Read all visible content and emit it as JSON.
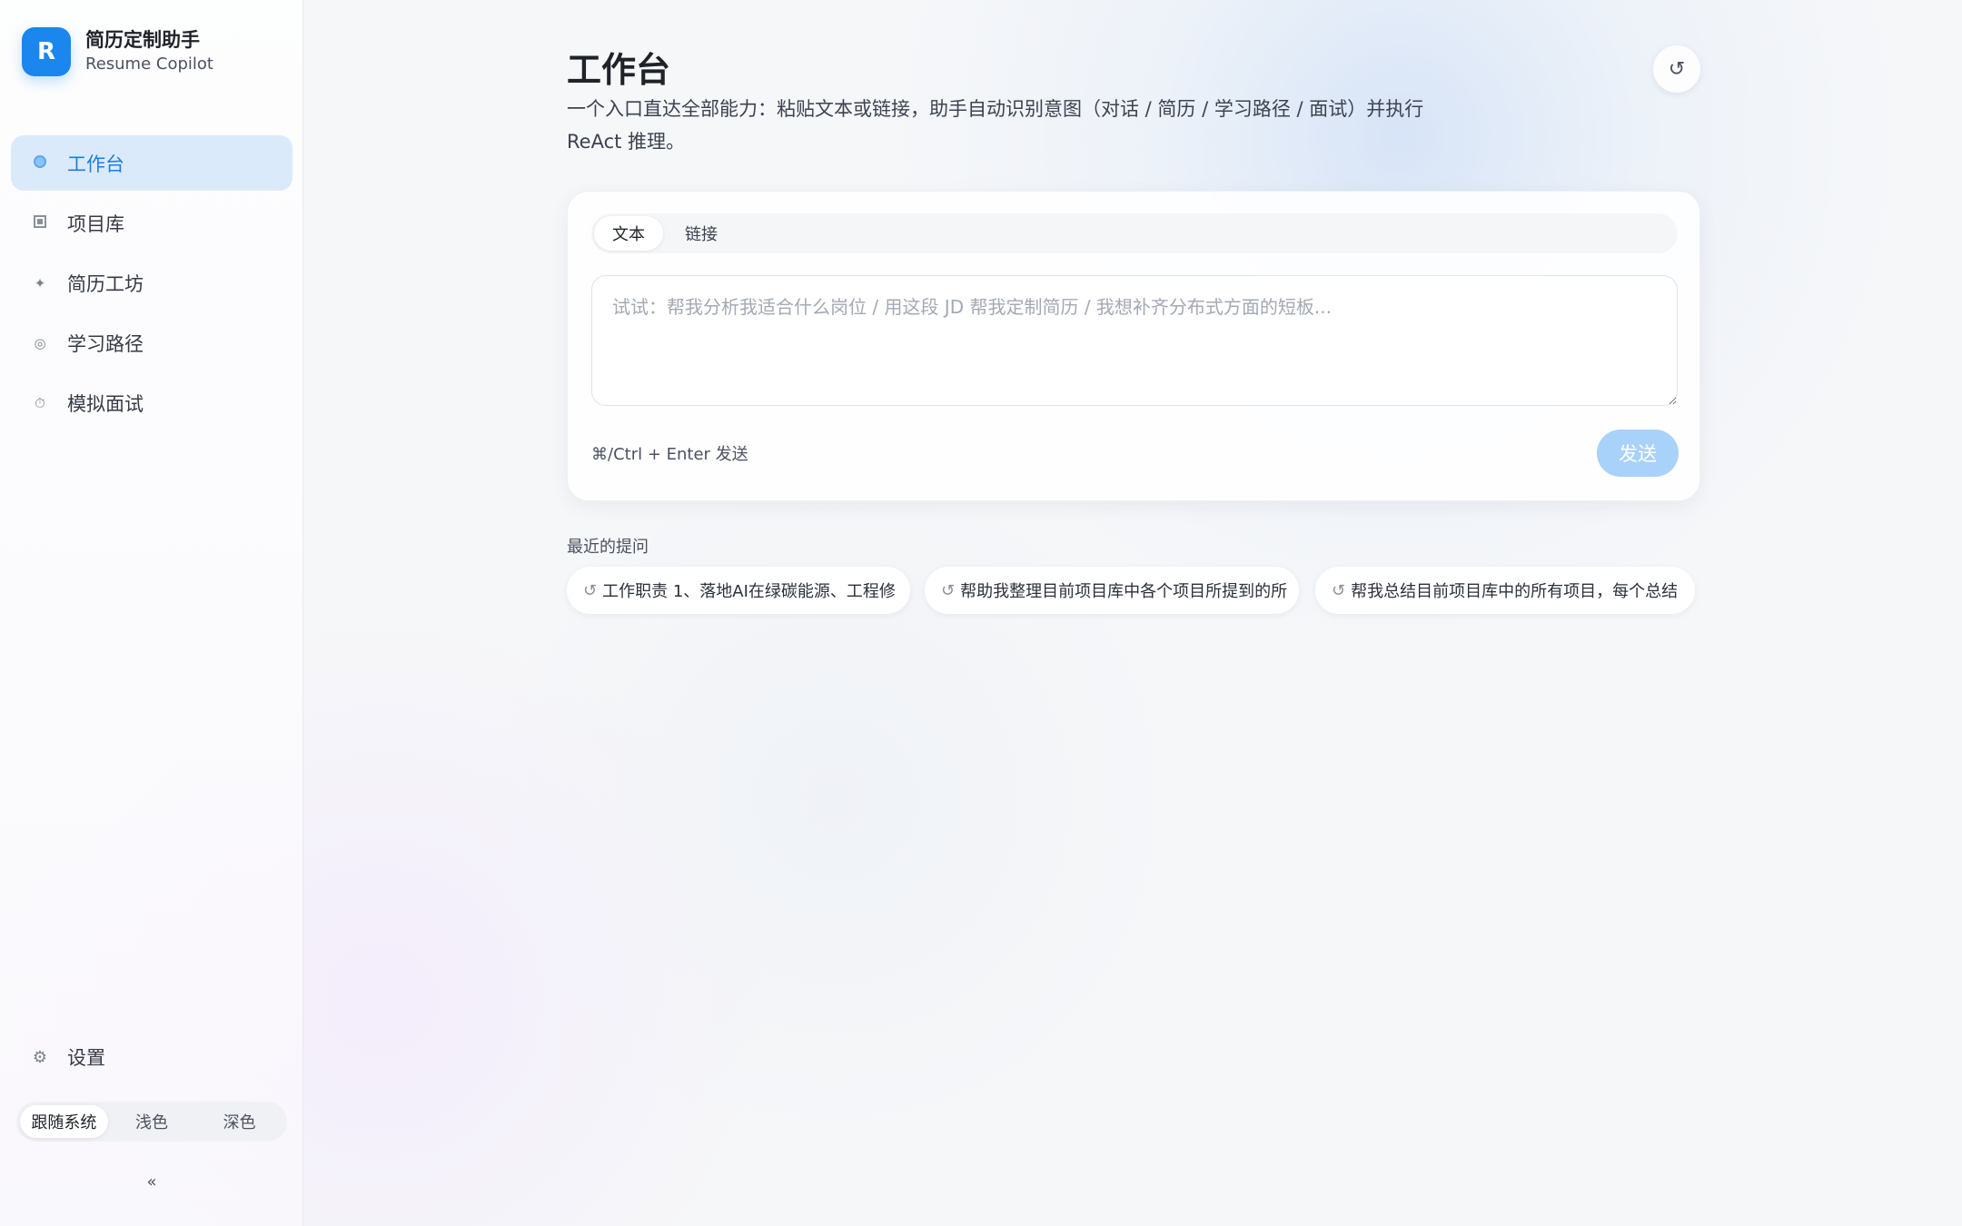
{
  "brand": {
    "logo_letter": "R",
    "title": "简历定制助手",
    "subtitle": "Resume Copilot",
    "accent_color": "#1a86ee"
  },
  "sidebar": {
    "items": [
      {
        "label": "工作台",
        "icon": "dot-icon",
        "active": true
      },
      {
        "label": "项目库",
        "icon": "square-icon",
        "glyph": "",
        "active": false
      },
      {
        "label": "简历工坊",
        "icon": "sparkle-icon",
        "glyph": "✦",
        "active": false
      },
      {
        "label": "学习路径",
        "icon": "target-icon",
        "glyph": "◎",
        "active": false
      },
      {
        "label": "模拟面试",
        "icon": "timer-icon",
        "glyph": "⏱",
        "active": false
      }
    ],
    "settings": {
      "label": "设置",
      "icon": "gear-icon",
      "glyph": "⚙"
    },
    "theme": {
      "options": [
        "跟随系统",
        "浅色",
        "深色"
      ],
      "selected": "跟随系统"
    },
    "collapse_glyph": "«"
  },
  "main": {
    "title": "工作台",
    "description": "一个入口直达全部能力：粘贴文本或链接，助手自动识别意图（对话 / 简历 / 学习路径 / 面试）并执行 ReAct 推理。",
    "refresh_glyph": "↺",
    "input_card": {
      "tabs": [
        {
          "label": "文本",
          "active": true
        },
        {
          "label": "链接",
          "active": false
        }
      ],
      "textarea_value": "",
      "textarea_placeholder": "试试：帮我分析我适合什么岗位 / 用这段 JD 帮我定制简历 / 我想补齐分布式方面的短板...",
      "shortcut_hint": "⌘/Ctrl + Enter 发送",
      "send_label": "发送"
    },
    "recent": {
      "title": "最近的提问",
      "icon_glyph": "↺",
      "items": [
        "工作职责 1、落地AI在绿碳能源、工程修",
        "帮助我整理目前项目库中各个项目所提到的所",
        "帮我总结目前项目库中的所有项目，每个总结"
      ]
    }
  }
}
